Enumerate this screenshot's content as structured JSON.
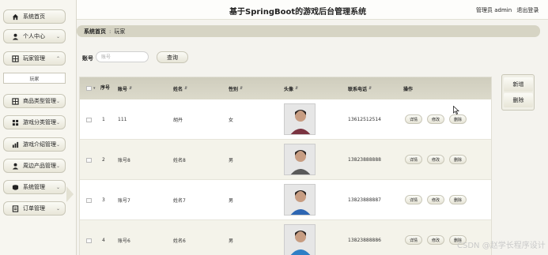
{
  "header": {
    "title": "基于SpringBoot的游戏后台管理系统",
    "user_label": "管理员 admin",
    "logout": "退出登录"
  },
  "sidebar": {
    "items": [
      {
        "label": "系统首页",
        "icon": "home-icon",
        "has_chevron": false
      },
      {
        "label": "个人中心",
        "icon": "user-icon",
        "has_chevron": true
      },
      {
        "label": "玩家管理",
        "icon": "grid-icon",
        "has_chevron": true
      },
      {
        "label": "商品类型管理",
        "icon": "grid-icon",
        "has_chevron": true
      },
      {
        "label": "游戏分类管理",
        "icon": "apps-icon",
        "has_chevron": true
      },
      {
        "label": "游戏介绍管理",
        "icon": "chart-icon",
        "has_chevron": true
      },
      {
        "label": "周边产品管理",
        "icon": "user-icon",
        "has_chevron": true
      },
      {
        "label": "系统管理",
        "icon": "gear-icon",
        "has_chevron": true
      },
      {
        "label": "订单管理",
        "icon": "document-icon",
        "has_chevron": true
      }
    ],
    "sub_item": "玩家"
  },
  "breadcrumb": {
    "home": "系统首页",
    "separator": ":",
    "current": "玩家"
  },
  "search": {
    "label": "账号",
    "placeholder": "账号",
    "button": "查询"
  },
  "actions": {
    "add": "新增",
    "delete": "删除"
  },
  "table": {
    "headers": {
      "index": "序号",
      "account": "账号",
      "name": "姓名",
      "gender": "性别",
      "avatar": "头像",
      "phone": "联系电话",
      "operation": "操作"
    },
    "row_buttons": {
      "detail": "详情",
      "edit": "修改",
      "delete": "删除"
    },
    "rows": [
      {
        "index": "1",
        "account": "111",
        "name": "胡丹",
        "gender": "女",
        "phone": "13612512514",
        "avatar_color": "#7a3340"
      },
      {
        "index": "2",
        "account": "账号8",
        "name": "姓名8",
        "gender": "男",
        "phone": "13823888888",
        "avatar_color": "#5a5a5a"
      },
      {
        "index": "3",
        "account": "账号7",
        "name": "姓名7",
        "gender": "男",
        "phone": "13823888887",
        "avatar_color": "#2d66b3"
      },
      {
        "index": "4",
        "account": "账号6",
        "name": "姓名6",
        "gender": "男",
        "phone": "13823888886",
        "avatar_color": "#2f7fc6"
      }
    ]
  },
  "watermark": "CSDN @赵学长程序设计"
}
